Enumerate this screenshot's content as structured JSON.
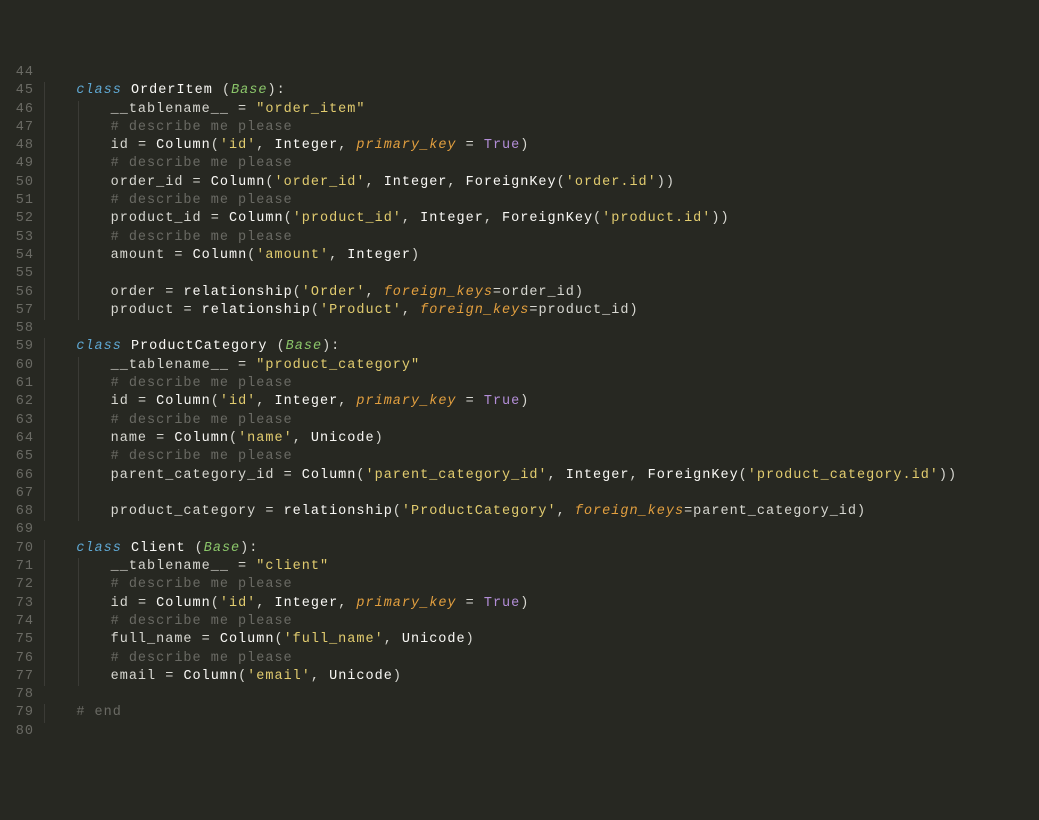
{
  "startLine": 44,
  "lines": [
    {
      "indent": 0,
      "tokens": []
    },
    {
      "indent": 1,
      "tokens": [
        [
          "kw",
          "class"
        ],
        [
          "punc",
          " "
        ],
        [
          "func",
          "OrderItem"
        ],
        [
          "punc",
          " ("
        ],
        [
          "base",
          "Base"
        ],
        [
          "punc",
          "):"
        ]
      ]
    },
    {
      "indent": 2,
      "tokens": [
        [
          "punc",
          "__tablename__ "
        ],
        [
          "punc",
          "="
        ],
        [
          "punc",
          " "
        ],
        [
          "str",
          "\"order_item\""
        ]
      ]
    },
    {
      "indent": 2,
      "tokens": [
        [
          "cmt",
          "# describe me please"
        ]
      ]
    },
    {
      "indent": 2,
      "tokens": [
        [
          "punc",
          "id "
        ],
        [
          "punc",
          "="
        ],
        [
          "punc",
          " "
        ],
        [
          "func",
          "Column"
        ],
        [
          "punc",
          "("
        ],
        [
          "str",
          "'id'"
        ],
        [
          "punc",
          ", "
        ],
        [
          "func",
          "Integer"
        ],
        [
          "punc",
          ", "
        ],
        [
          "param",
          "primary_key"
        ],
        [
          "punc",
          " "
        ],
        [
          "punc",
          "="
        ],
        [
          "punc",
          " "
        ],
        [
          "bool",
          "True"
        ],
        [
          "punc",
          ")"
        ]
      ]
    },
    {
      "indent": 2,
      "tokens": [
        [
          "cmt",
          "# describe me please"
        ]
      ]
    },
    {
      "indent": 2,
      "tokens": [
        [
          "punc",
          "order_id "
        ],
        [
          "punc",
          "="
        ],
        [
          "punc",
          " "
        ],
        [
          "func",
          "Column"
        ],
        [
          "punc",
          "("
        ],
        [
          "str",
          "'order_id'"
        ],
        [
          "punc",
          ", "
        ],
        [
          "func",
          "Integer"
        ],
        [
          "punc",
          ", "
        ],
        [
          "func",
          "ForeignKey"
        ],
        [
          "punc",
          "("
        ],
        [
          "str",
          "'order.id'"
        ],
        [
          "punc",
          "))"
        ]
      ]
    },
    {
      "indent": 2,
      "tokens": [
        [
          "cmt",
          "# describe me please"
        ]
      ]
    },
    {
      "indent": 2,
      "tokens": [
        [
          "punc",
          "product_id "
        ],
        [
          "punc",
          "="
        ],
        [
          "punc",
          " "
        ],
        [
          "func",
          "Column"
        ],
        [
          "punc",
          "("
        ],
        [
          "str",
          "'product_id'"
        ],
        [
          "punc",
          ", "
        ],
        [
          "func",
          "Integer"
        ],
        [
          "punc",
          ", "
        ],
        [
          "func",
          "ForeignKey"
        ],
        [
          "punc",
          "("
        ],
        [
          "str",
          "'product.id'"
        ],
        [
          "punc",
          "))"
        ]
      ]
    },
    {
      "indent": 2,
      "tokens": [
        [
          "cmt",
          "# describe me please"
        ]
      ]
    },
    {
      "indent": 2,
      "tokens": [
        [
          "punc",
          "amount "
        ],
        [
          "punc",
          "="
        ],
        [
          "punc",
          " "
        ],
        [
          "func",
          "Column"
        ],
        [
          "punc",
          "("
        ],
        [
          "str",
          "'amount'"
        ],
        [
          "punc",
          ", "
        ],
        [
          "func",
          "Integer"
        ],
        [
          "punc",
          ")"
        ]
      ]
    },
    {
      "indent": 2,
      "tokens": []
    },
    {
      "indent": 2,
      "tokens": [
        [
          "punc",
          "order "
        ],
        [
          "punc",
          "="
        ],
        [
          "punc",
          " "
        ],
        [
          "func",
          "relationship"
        ],
        [
          "punc",
          "("
        ],
        [
          "str",
          "'Order'"
        ],
        [
          "punc",
          ", "
        ],
        [
          "param",
          "foreign_keys"
        ],
        [
          "punc",
          "="
        ],
        [
          "punc",
          "order_id)"
        ]
      ]
    },
    {
      "indent": 2,
      "tokens": [
        [
          "punc",
          "product "
        ],
        [
          "punc",
          "="
        ],
        [
          "punc",
          " "
        ],
        [
          "func",
          "relationship"
        ],
        [
          "punc",
          "("
        ],
        [
          "str",
          "'Product'"
        ],
        [
          "punc",
          ", "
        ],
        [
          "param",
          "foreign_keys"
        ],
        [
          "punc",
          "="
        ],
        [
          "punc",
          "product_id)"
        ]
      ]
    },
    {
      "indent": 0,
      "tokens": []
    },
    {
      "indent": 1,
      "tokens": [
        [
          "kw",
          "class"
        ],
        [
          "punc",
          " "
        ],
        [
          "func",
          "ProductCategory"
        ],
        [
          "punc",
          " ("
        ],
        [
          "base",
          "Base"
        ],
        [
          "punc",
          "):"
        ]
      ]
    },
    {
      "indent": 2,
      "tokens": [
        [
          "punc",
          "__tablename__ "
        ],
        [
          "punc",
          "="
        ],
        [
          "punc",
          " "
        ],
        [
          "str",
          "\"product_category\""
        ]
      ]
    },
    {
      "indent": 2,
      "tokens": [
        [
          "cmt",
          "# describe me please"
        ]
      ]
    },
    {
      "indent": 2,
      "tokens": [
        [
          "punc",
          "id "
        ],
        [
          "punc",
          "="
        ],
        [
          "punc",
          " "
        ],
        [
          "func",
          "Column"
        ],
        [
          "punc",
          "("
        ],
        [
          "str",
          "'id'"
        ],
        [
          "punc",
          ", "
        ],
        [
          "func",
          "Integer"
        ],
        [
          "punc",
          ", "
        ],
        [
          "param",
          "primary_key"
        ],
        [
          "punc",
          " "
        ],
        [
          "punc",
          "="
        ],
        [
          "punc",
          " "
        ],
        [
          "bool",
          "True"
        ],
        [
          "punc",
          ")"
        ]
      ]
    },
    {
      "indent": 2,
      "tokens": [
        [
          "cmt",
          "# describe me please"
        ]
      ]
    },
    {
      "indent": 2,
      "tokens": [
        [
          "punc",
          "name "
        ],
        [
          "punc",
          "="
        ],
        [
          "punc",
          " "
        ],
        [
          "func",
          "Column"
        ],
        [
          "punc",
          "("
        ],
        [
          "str",
          "'name'"
        ],
        [
          "punc",
          ", "
        ],
        [
          "func",
          "Unicode"
        ],
        [
          "punc",
          ")"
        ]
      ]
    },
    {
      "indent": 2,
      "tokens": [
        [
          "cmt",
          "# describe me please"
        ]
      ]
    },
    {
      "indent": 2,
      "tokens": [
        [
          "punc",
          "parent_category_id "
        ],
        [
          "punc",
          "="
        ],
        [
          "punc",
          " "
        ],
        [
          "func",
          "Column"
        ],
        [
          "punc",
          "("
        ],
        [
          "str",
          "'parent_category_id'"
        ],
        [
          "punc",
          ", "
        ],
        [
          "func",
          "Integer"
        ],
        [
          "punc",
          ", "
        ],
        [
          "func",
          "ForeignKey"
        ],
        [
          "punc",
          "("
        ],
        [
          "str",
          "'product_category.id'"
        ],
        [
          "punc",
          "))"
        ]
      ]
    },
    {
      "indent": 2,
      "tokens": []
    },
    {
      "indent": 2,
      "tokens": [
        [
          "punc",
          "product_category "
        ],
        [
          "punc",
          "="
        ],
        [
          "punc",
          " "
        ],
        [
          "func",
          "relationship"
        ],
        [
          "punc",
          "("
        ],
        [
          "str",
          "'ProductCategory'"
        ],
        [
          "punc",
          ", "
        ],
        [
          "param",
          "foreign_keys"
        ],
        [
          "punc",
          "="
        ],
        [
          "punc",
          "parent_category_id)"
        ]
      ]
    },
    {
      "indent": 0,
      "tokens": []
    },
    {
      "indent": 1,
      "tokens": [
        [
          "kw",
          "class"
        ],
        [
          "punc",
          " "
        ],
        [
          "func",
          "Client"
        ],
        [
          "punc",
          " ("
        ],
        [
          "base",
          "Base"
        ],
        [
          "punc",
          "):"
        ]
      ]
    },
    {
      "indent": 2,
      "tokens": [
        [
          "punc",
          "__tablename__ "
        ],
        [
          "punc",
          "="
        ],
        [
          "punc",
          " "
        ],
        [
          "str",
          "\"client\""
        ]
      ]
    },
    {
      "indent": 2,
      "tokens": [
        [
          "cmt",
          "# describe me please"
        ]
      ]
    },
    {
      "indent": 2,
      "tokens": [
        [
          "punc",
          "id "
        ],
        [
          "punc",
          "="
        ],
        [
          "punc",
          " "
        ],
        [
          "func",
          "Column"
        ],
        [
          "punc",
          "("
        ],
        [
          "str",
          "'id'"
        ],
        [
          "punc",
          ", "
        ],
        [
          "func",
          "Integer"
        ],
        [
          "punc",
          ", "
        ],
        [
          "param",
          "primary_key"
        ],
        [
          "punc",
          " "
        ],
        [
          "punc",
          "="
        ],
        [
          "punc",
          " "
        ],
        [
          "bool",
          "True"
        ],
        [
          "punc",
          ")"
        ]
      ]
    },
    {
      "indent": 2,
      "tokens": [
        [
          "cmt",
          "# describe me please"
        ]
      ]
    },
    {
      "indent": 2,
      "tokens": [
        [
          "punc",
          "full_name "
        ],
        [
          "punc",
          "="
        ],
        [
          "punc",
          " "
        ],
        [
          "func",
          "Column"
        ],
        [
          "punc",
          "("
        ],
        [
          "str",
          "'full_name'"
        ],
        [
          "punc",
          ", "
        ],
        [
          "func",
          "Unicode"
        ],
        [
          "punc",
          ")"
        ]
      ]
    },
    {
      "indent": 2,
      "tokens": [
        [
          "cmt",
          "# describe me please"
        ]
      ]
    },
    {
      "indent": 2,
      "tokens": [
        [
          "punc",
          "email "
        ],
        [
          "punc",
          "="
        ],
        [
          "punc",
          " "
        ],
        [
          "func",
          "Column"
        ],
        [
          "punc",
          "("
        ],
        [
          "str",
          "'email'"
        ],
        [
          "punc",
          ", "
        ],
        [
          "func",
          "Unicode"
        ],
        [
          "punc",
          ")"
        ]
      ]
    },
    {
      "indent": 0,
      "tokens": []
    },
    {
      "indent": 1,
      "tokens": [
        [
          "cmt",
          "# end"
        ]
      ]
    },
    {
      "indent": 0,
      "tokens": []
    }
  ]
}
